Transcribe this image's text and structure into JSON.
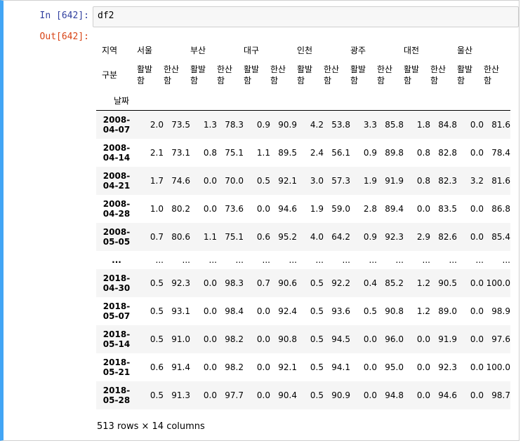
{
  "in_prompt": "In [642]:",
  "out_prompt": "Out[642]:",
  "code": "df2",
  "table": {
    "level1_label": "지역",
    "level2_label": "구분",
    "index_name": "날짜",
    "regions": [
      "서울",
      "부산",
      "대구",
      "인천",
      "광주",
      "대전",
      "울산"
    ],
    "sub_col_1": [
      "활발",
      "함"
    ],
    "sub_col_2": [
      "한산",
      "함"
    ],
    "rows": [
      {
        "date": [
          "2008-",
          "04-07"
        ],
        "values": [
          "2.0",
          "73.5",
          "1.3",
          "78.3",
          "0.9",
          "90.9",
          "4.2",
          "53.8",
          "3.3",
          "85.8",
          "1.8",
          "84.8",
          "0.0",
          "81.6"
        ]
      },
      {
        "date": [
          "2008-",
          "04-14"
        ],
        "values": [
          "2.1",
          "73.1",
          "0.8",
          "75.1",
          "1.1",
          "89.5",
          "2.4",
          "56.1",
          "0.9",
          "89.8",
          "0.8",
          "82.8",
          "0.0",
          "78.4"
        ]
      },
      {
        "date": [
          "2008-",
          "04-21"
        ],
        "values": [
          "1.7",
          "74.6",
          "0.0",
          "70.0",
          "0.5",
          "92.1",
          "3.0",
          "57.3",
          "1.9",
          "91.9",
          "0.8",
          "82.3",
          "3.2",
          "81.6"
        ]
      },
      {
        "date": [
          "2008-",
          "04-28"
        ],
        "values": [
          "1.0",
          "80.2",
          "0.0",
          "73.6",
          "0.0",
          "94.6",
          "1.9",
          "59.0",
          "2.8",
          "89.4",
          "0.0",
          "83.5",
          "0.0",
          "86.8"
        ]
      },
      {
        "date": [
          "2008-",
          "05-05"
        ],
        "values": [
          "0.7",
          "80.6",
          "1.1",
          "75.1",
          "0.6",
          "95.2",
          "4.0",
          "64.2",
          "0.9",
          "92.3",
          "2.9",
          "82.6",
          "0.0",
          "85.4"
        ]
      },
      {
        "ellipsis": true,
        "date": [
          "..."
        ],
        "values": [
          "...",
          "...",
          "...",
          "...",
          "...",
          "...",
          "...",
          "...",
          "...",
          "...",
          "...",
          "...",
          "...",
          "..."
        ]
      },
      {
        "date": [
          "2018-",
          "04-30"
        ],
        "values": [
          "0.5",
          "92.3",
          "0.0",
          "98.3",
          "0.7",
          "90.6",
          "0.5",
          "92.2",
          "0.4",
          "85.2",
          "1.2",
          "90.5",
          "0.0",
          "100.0"
        ]
      },
      {
        "date": [
          "2018-",
          "05-07"
        ],
        "values": [
          "0.5",
          "93.1",
          "0.0",
          "98.4",
          "0.0",
          "92.4",
          "0.5",
          "93.6",
          "0.5",
          "90.8",
          "1.2",
          "89.0",
          "0.0",
          "98.9"
        ]
      },
      {
        "date": [
          "2018-",
          "05-14"
        ],
        "values": [
          "0.5",
          "91.0",
          "0.0",
          "98.2",
          "0.0",
          "90.8",
          "0.5",
          "94.5",
          "0.0",
          "96.0",
          "0.0",
          "91.9",
          "0.0",
          "97.6"
        ]
      },
      {
        "date": [
          "2018-",
          "05-21"
        ],
        "values": [
          "0.6",
          "91.4",
          "0.0",
          "98.2",
          "0.0",
          "92.1",
          "0.5",
          "94.1",
          "0.0",
          "95.0",
          "0.0",
          "92.3",
          "0.0",
          "100.0"
        ]
      },
      {
        "date": [
          "2018-",
          "05-28"
        ],
        "values": [
          "0.5",
          "91.3",
          "0.0",
          "97.7",
          "0.0",
          "90.4",
          "0.5",
          "90.9",
          "0.0",
          "94.8",
          "0.0",
          "94.6",
          "0.0",
          "98.7"
        ]
      }
    ]
  },
  "summary": "513 rows × 14 columns",
  "colors": {
    "cell_border_accent": "#42a5f5",
    "in_prompt": "#303f9f",
    "out_prompt": "#d84315"
  }
}
